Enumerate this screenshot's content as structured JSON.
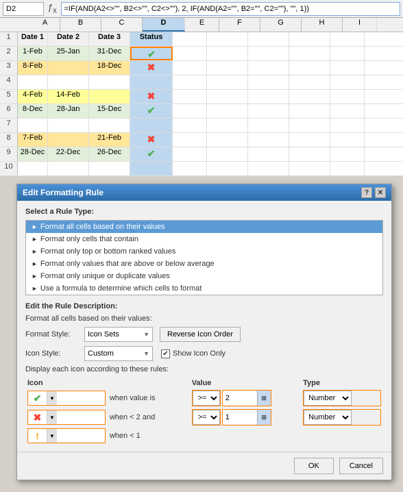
{
  "formulaBar": {
    "cellRef": "D2",
    "formula": "=IF(AND(A2<>\"\", B2<>\"\", C2<>\"\"), 2, IF(AND(A2=\"\", B2=\"\", C2=\"\"), \"\", 1))"
  },
  "columns": [
    "A",
    "B",
    "C",
    "D",
    "E",
    "F",
    "G",
    "H",
    "I"
  ],
  "headers": {
    "row1": [
      "Date 1",
      "Date 2",
      "Date 3",
      "Status"
    ]
  },
  "rows": [
    {
      "num": "1",
      "cells": [
        "Date 1",
        "Date 2",
        "Date 3",
        "Status",
        "",
        "",
        "",
        "",
        ""
      ]
    },
    {
      "num": "2",
      "cells": [
        "1-Feb",
        "25-Jan",
        "31-Dec",
        "✔",
        "",
        "",
        "",
        "",
        ""
      ]
    },
    {
      "num": "3",
      "cells": [
        "8-Feb",
        "",
        "18-Dec",
        "✖",
        "",
        "",
        "",
        "",
        ""
      ]
    },
    {
      "num": "4",
      "cells": [
        "",
        "",
        "",
        "",
        "",
        "",
        "",
        "",
        ""
      ]
    },
    {
      "num": "5",
      "cells": [
        "4-Feb",
        "14-Feb",
        "",
        "✖",
        "",
        "",
        "",
        "",
        ""
      ]
    },
    {
      "num": "6",
      "cells": [
        "8-Dec",
        "28-Jan",
        "15-Dec",
        "✔",
        "",
        "",
        "",
        "",
        ""
      ]
    },
    {
      "num": "7",
      "cells": [
        "",
        "",
        "",
        "",
        "",
        "",
        "",
        "",
        ""
      ]
    },
    {
      "num": "8",
      "cells": [
        "7-Feb",
        "",
        "21-Feb",
        "✖",
        "",
        "",
        "",
        "",
        ""
      ]
    },
    {
      "num": "9",
      "cells": [
        "28-Dec",
        "22-Dec",
        "26-Dec",
        "✔",
        "",
        "",
        "",
        "",
        ""
      ]
    },
    {
      "num": "10",
      "cells": [
        "",
        "",
        "",
        "",
        "",
        "",
        "",
        "",
        ""
      ]
    }
  ],
  "dialog": {
    "title": "Edit Formatting Rule",
    "helpBtn": "?",
    "closeBtn": "✕",
    "selectRuleLabel": "Select a Rule Type:",
    "ruleTypes": [
      "Format all cells based on their values",
      "Format only cells that contain",
      "Format only top or bottom ranked values",
      "Format only values that are above or below average",
      "Format only unique or duplicate values",
      "Use a formula to determine which cells to format"
    ],
    "selectedRule": 0,
    "editDescLabel": "Edit the Rule Description:",
    "descSubtitle": "Format all cells based on their values:",
    "formatStyleLabel": "Format Style:",
    "formatStyleValue": "Icon Sets",
    "reverseBtn": "Reverse Icon Order",
    "iconStyleLabel": "Icon Style:",
    "iconStyleValue": "Custom",
    "showIconOnly": "Show Icon Only",
    "showIconOnlyChecked": true,
    "displayLabel": "Display each icon according to these rules:",
    "tableHeaders": [
      "Icon",
      "",
      "Value",
      "Type"
    ],
    "iconRows": [
      {
        "icon": "✔",
        "iconColor": "green",
        "condition": "when value is",
        "operator": ">=",
        "value": "2",
        "type": "Number"
      },
      {
        "icon": "✖",
        "iconColor": "red",
        "condition": "when < 2 and",
        "operator": ">=",
        "value": "1",
        "type": "Number"
      },
      {
        "icon": "!",
        "iconColor": "orange",
        "condition": "when < 1",
        "operator": "",
        "value": "",
        "type": ""
      }
    ],
    "okBtn": "OK",
    "cancelBtn": "Cancel"
  }
}
